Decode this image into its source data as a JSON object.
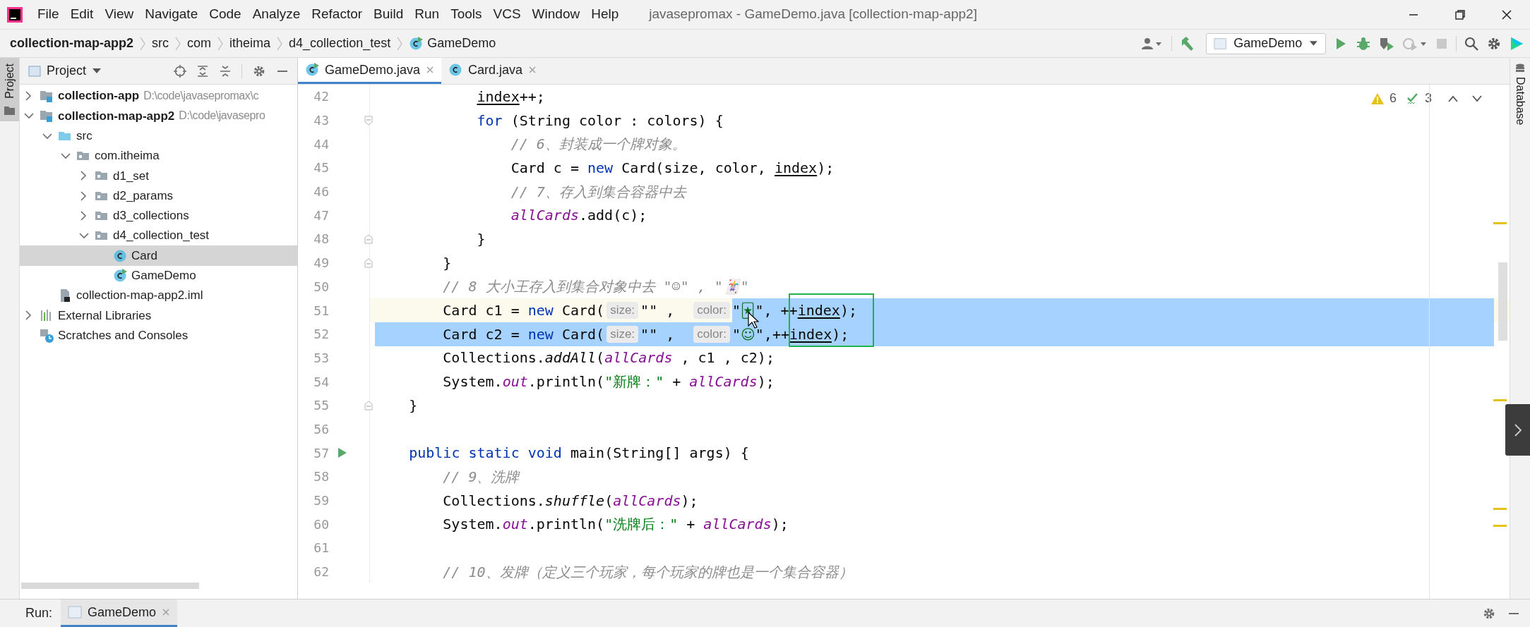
{
  "menu": [
    "File",
    "Edit",
    "View",
    "Navigate",
    "Code",
    "Analyze",
    "Refactor",
    "Build",
    "Run",
    "Tools",
    "VCS",
    "Window",
    "Help"
  ],
  "window_title": "javasepromax - GameDemo.java [collection-map-app2]",
  "breadcrumbs": [
    {
      "label": "collection-map-app2",
      "kind": "project"
    },
    {
      "label": "src",
      "kind": "dir"
    },
    {
      "label": "com",
      "kind": "dir"
    },
    {
      "label": "itheima",
      "kind": "dir"
    },
    {
      "label": "d4_collection_test",
      "kind": "dir"
    },
    {
      "label": "GameDemo",
      "kind": "runnable"
    }
  ],
  "run_config": "GameDemo",
  "left_stripe": [
    {
      "label": "Project",
      "selected": true
    }
  ],
  "right_stripe": [
    {
      "label": "Database",
      "selected": false
    }
  ],
  "project_panel": {
    "title": "Project",
    "tree": [
      {
        "label": "collection-app",
        "kind": "module",
        "path": "D:\\code\\javasepromax\\c",
        "expanded": false,
        "selected": false
      },
      {
        "label": "collection-map-app2",
        "kind": "module",
        "path": "D:\\code\\javasepro",
        "expanded": true,
        "selected": false,
        "children": [
          {
            "label": "src",
            "kind": "source",
            "expanded": true,
            "selected": false,
            "children": [
              {
                "label": "com.itheima",
                "kind": "package",
                "expanded": true,
                "selected": false,
                "children": [
                  {
                    "label": "d1_set",
                    "kind": "package",
                    "expanded": false,
                    "selected": false
                  },
                  {
                    "label": "d2_params",
                    "kind": "package",
                    "expanded": false,
                    "selected": false
                  },
                  {
                    "label": "d3_collections",
                    "kind": "package",
                    "expanded": false,
                    "selected": false
                  },
                  {
                    "label": "d4_collection_test",
                    "kind": "package",
                    "expanded": true,
                    "selected": false,
                    "children": [
                      {
                        "label": "Card",
                        "kind": "class",
                        "selected": true
                      },
                      {
                        "label": "GameDemo",
                        "kind": "runnable",
                        "selected": false
                      }
                    ]
                  }
                ]
              }
            ]
          },
          {
            "label": "collection-map-app2.iml",
            "kind": "iml",
            "selected": false
          }
        ]
      },
      {
        "label": "External Libraries",
        "kind": "libraries",
        "expanded": false,
        "selected": false
      },
      {
        "label": "Scratches and Consoles",
        "kind": "scratches",
        "selected": false
      }
    ]
  },
  "editor_tabs": [
    {
      "label": "GameDemo.java",
      "kind": "runnable",
      "selected": true
    },
    {
      "label": "Card.java",
      "kind": "class",
      "selected": false
    }
  ],
  "inspections": {
    "warnings": "6",
    "weak_warnings": "3"
  },
  "code_lines": [
    {
      "number": "42",
      "current": false,
      "selected": false,
      "tokens": [
        {
          "text": "            index",
          "kind": "underlined",
          "selected": false
        },
        {
          "text": "++;",
          "kind": "plain",
          "selected": false
        }
      ]
    },
    {
      "number": "43",
      "current": false,
      "selected": false,
      "gutter": {
        "kind": "fold_start"
      },
      "tokens": [
        {
          "text": "            for",
          "kind": "keyword",
          "selected": false
        },
        {
          "text": " (String color : colors) {",
          "kind": "plain",
          "selected": false
        }
      ]
    },
    {
      "number": "44",
      "current": false,
      "selected": false,
      "tokens": [
        {
          "text": "                // 6、封装成一个牌对象。",
          "kind": "comment",
          "selected": false
        }
      ]
    },
    {
      "number": "45",
      "current": false,
      "selected": false,
      "tokens": [
        {
          "text": "                Card c = ",
          "kind": "plain",
          "selected": false
        },
        {
          "text": "new",
          "kind": "keyword",
          "selected": false
        },
        {
          "text": " Card(size, color, ",
          "kind": "plain",
          "selected": false
        },
        {
          "text": "index",
          "kind": "underlined",
          "selected": false
        },
        {
          "text": ");",
          "kind": "plain",
          "selected": false
        }
      ]
    },
    {
      "number": "46",
      "current": false,
      "selected": false,
      "tokens": [
        {
          "text": "                // 7、存入到集合容器中去",
          "kind": "comment",
          "selected": false
        }
      ]
    },
    {
      "number": "47",
      "current": false,
      "selected": false,
      "tokens": [
        {
          "text": "                allCards",
          "kind": "field",
          "selected": false
        },
        {
          "text": ".add(c);",
          "kind": "plain",
          "selected": false
        }
      ]
    },
    {
      "number": "48",
      "current": false,
      "selected": false,
      "gutter": {
        "kind": "fold_end"
      },
      "tokens": [
        {
          "text": "            }",
          "kind": "plain",
          "selected": false
        }
      ]
    },
    {
      "number": "49",
      "current": false,
      "selected": false,
      "gutter": {
        "kind": "fold_end"
      },
      "tokens": [
        {
          "text": "        }",
          "kind": "plain",
          "selected": false
        }
      ]
    },
    {
      "number": "50",
      "current": false,
      "selected": false,
      "tokens": [
        {
          "text": "        // 8 大小王存入到集合对象中去 \"☺\" , \"🃏\"",
          "kind": "comment",
          "selected": false
        }
      ]
    },
    {
      "number": "51",
      "current": true,
      "selected": true,
      "tokens": [
        {
          "text": "        Card c1 = ",
          "kind": "plain",
          "selected": false
        },
        {
          "text": "new",
          "kind": "keyword",
          "selected": false
        },
        {
          "text": " Card(",
          "kind": "plain",
          "selected": false
        },
        {
          "text": "size:",
          "kind": "hint",
          "selected": false
        },
        {
          "text": "\"\" ,  ",
          "kind": "plain",
          "selected": false
        },
        {
          "text": "color:",
          "kind": "hint",
          "selected": false
        },
        {
          "text": "\"",
          "kind": "plain",
          "selected": true
        },
        {
          "text": "🃏",
          "kind": "emoji",
          "selected": true
        },
        {
          "text": "\", ++",
          "kind": "plain",
          "selected": true
        },
        {
          "text": "index",
          "kind": "underlined",
          "selected": true
        },
        {
          "text": ");",
          "kind": "plain",
          "selected": true
        }
      ]
    },
    {
      "number": "52",
      "current": false,
      "selected": true,
      "tokens": [
        {
          "text": "        Card c2 = ",
          "kind": "plain",
          "selected": true
        },
        {
          "text": "new",
          "kind": "keyword",
          "selected": true
        },
        {
          "text": " Card(",
          "kind": "plain",
          "selected": true
        },
        {
          "text": "size:",
          "kind": "hint",
          "selected": true
        },
        {
          "text": "\"\" ,  ",
          "kind": "plain",
          "selected": true
        },
        {
          "text": "color:",
          "kind": "hint",
          "selected": true
        },
        {
          "text": "\"",
          "kind": "plain",
          "selected": true
        },
        {
          "text": "☺",
          "kind": "emoji",
          "selected": true
        },
        {
          "text": "\",++",
          "kind": "plain",
          "selected": true
        },
        {
          "text": "index",
          "kind": "underlined",
          "selected": true
        },
        {
          "text": ");",
          "kind": "plain",
          "selected": true
        }
      ]
    },
    {
      "number": "53",
      "current": false,
      "selected": false,
      "tokens": [
        {
          "text": "        Collections.",
          "kind": "plain",
          "selected": false
        },
        {
          "text": "addAll",
          "kind": "static_call",
          "selected": false
        },
        {
          "text": "(",
          "kind": "plain",
          "selected": false
        },
        {
          "text": "allCards",
          "kind": "field",
          "selected": false
        },
        {
          "text": " , c1 , c2);",
          "kind": "plain",
          "selected": false
        }
      ]
    },
    {
      "number": "54",
      "current": false,
      "selected": false,
      "tokens": [
        {
          "text": "        System.",
          "kind": "plain",
          "selected": false
        },
        {
          "text": "out",
          "kind": "field",
          "selected": false
        },
        {
          "text": ".println(",
          "kind": "plain",
          "selected": false
        },
        {
          "text": "\"新牌：\"",
          "kind": "string",
          "selected": false
        },
        {
          "text": " + ",
          "kind": "plain",
          "selected": false
        },
        {
          "text": "allCards",
          "kind": "field",
          "selected": false
        },
        {
          "text": ");",
          "kind": "plain",
          "selected": false
        }
      ]
    },
    {
      "number": "55",
      "current": false,
      "selected": false,
      "gutter": {
        "kind": "fold_end"
      },
      "tokens": [
        {
          "text": "    }",
          "kind": "plain",
          "selected": false
        }
      ]
    },
    {
      "number": "56",
      "current": false,
      "selected": false
    },
    {
      "number": "57",
      "current": false,
      "selected": false,
      "gutter": {
        "kind": "run"
      },
      "tokens": [
        {
          "text": "    public static void",
          "kind": "keyword",
          "selected": false
        },
        {
          "text": " main(String[] args) {",
          "kind": "plain",
          "selected": false
        }
      ]
    },
    {
      "number": "58",
      "current": false,
      "selected": false,
      "tokens": [
        {
          "text": "        // 9、洗牌",
          "kind": "comment",
          "selected": false
        }
      ]
    },
    {
      "number": "59",
      "current": false,
      "selected": false,
      "tokens": [
        {
          "text": "        Collections.",
          "kind": "plain",
          "selected": false
        },
        {
          "text": "shuffle",
          "kind": "static_call",
          "selected": false
        },
        {
          "text": "(",
          "kind": "plain",
          "selected": false
        },
        {
          "text": "allCards",
          "kind": "field",
          "selected": false
        },
        {
          "text": ");",
          "kind": "plain",
          "selected": false
        }
      ]
    },
    {
      "number": "60",
      "current": false,
      "selected": false,
      "tokens": [
        {
          "text": "        System.",
          "kind": "plain",
          "selected": false
        },
        {
          "text": "out",
          "kind": "field",
          "selected": false
        },
        {
          "text": ".println(",
          "kind": "plain",
          "selected": false
        },
        {
          "text": "\"洗牌后：\"",
          "kind": "string",
          "selected": false
        },
        {
          "text": " + ",
          "kind": "plain",
          "selected": false
        },
        {
          "text": "allCards",
          "kind": "field",
          "selected": false
        },
        {
          "text": ");",
          "kind": "plain",
          "selected": false
        }
      ]
    },
    {
      "number": "61",
      "current": false,
      "selected": false
    },
    {
      "number": "62",
      "current": false,
      "selected": false,
      "tokens": [
        {
          "text": "        // 10、发牌（定义三个玩家，每个玩家的牌也是一个集合容器）",
          "kind": "comment",
          "selected": false
        }
      ]
    }
  ],
  "run_panel": {
    "label": "Run:",
    "tabs": [
      {
        "label": "GameDemo",
        "selected": true
      }
    ]
  }
}
